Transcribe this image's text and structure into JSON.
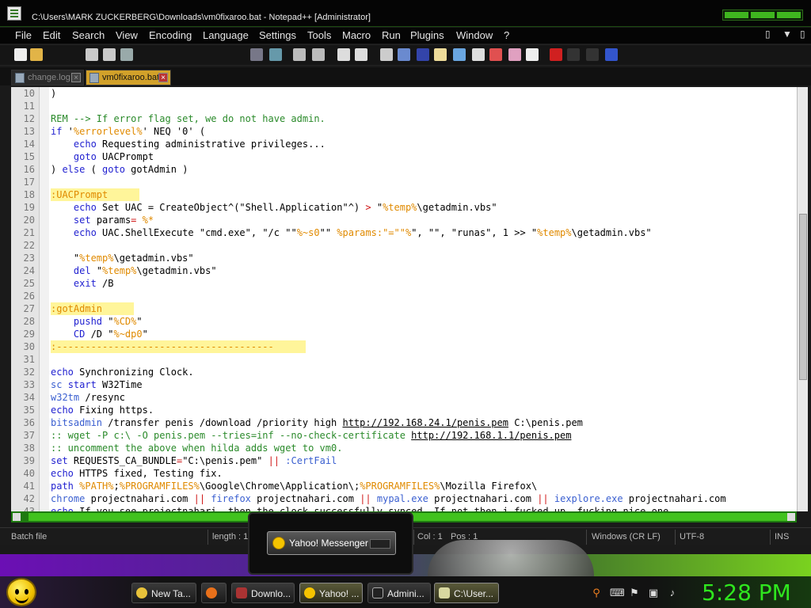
{
  "window": {
    "title": "C:\\Users\\MARK ZUCKERBERG\\Downloads\\vm0fixaroo.bat - Notepad++ [Administrator]"
  },
  "menu": {
    "items": [
      "File",
      "Edit",
      "Search",
      "View",
      "Encoding",
      "Language",
      "Settings",
      "Tools",
      "Macro",
      "Run",
      "Plugins",
      "Window",
      "?"
    ],
    "right_controls": [
      "▯",
      "▼",
      "▯"
    ]
  },
  "tabs": [
    {
      "label": "change.log",
      "active": false
    },
    {
      "label": "vm0fixaroo.bat",
      "active": true
    }
  ],
  "editor": {
    "lines": [
      {
        "n": "10",
        "hl": false,
        "segs": [
          [
            ")",
            ""
          ]
        ]
      },
      {
        "n": "11",
        "hl": false,
        "segs": []
      },
      {
        "n": "12",
        "hl": false,
        "segs": [
          [
            "REM --> If error flag set, we do not have admin.",
            "com"
          ]
        ]
      },
      {
        "n": "13",
        "hl": false,
        "segs": [
          [
            "if",
            "kw"
          ],
          [
            " '",
            ""
          ],
          [
            "%errorlevel%",
            "var"
          ],
          [
            "' NEQ '0' (",
            ""
          ]
        ]
      },
      {
        "n": "14",
        "hl": false,
        "segs": [
          [
            "    ",
            ""
          ],
          [
            "echo",
            "kw"
          ],
          [
            " Requesting administrative privileges...",
            ""
          ]
        ]
      },
      {
        "n": "15",
        "hl": false,
        "segs": [
          [
            "    ",
            ""
          ],
          [
            "goto",
            "kw"
          ],
          [
            " UACPrompt",
            ""
          ]
        ]
      },
      {
        "n": "16",
        "hl": false,
        "segs": [
          [
            ") ",
            ""
          ],
          [
            "else",
            "kw"
          ],
          [
            " ( ",
            ""
          ],
          [
            "goto",
            "kw"
          ],
          [
            " gotAdmin )",
            ""
          ]
        ]
      },
      {
        "n": "17",
        "hl": false,
        "segs": []
      },
      {
        "n": "18",
        "hl": true,
        "segs": [
          [
            ":UACPrompt",
            "lbl"
          ]
        ]
      },
      {
        "n": "19",
        "hl": false,
        "segs": [
          [
            "    ",
            ""
          ],
          [
            "echo",
            "kw"
          ],
          [
            " Set UAC = CreateObject^(\"Shell.Application\"^) ",
            ""
          ],
          [
            ">",
            "op"
          ],
          [
            " \"",
            ""
          ],
          [
            "%temp%",
            "var"
          ],
          [
            "\\getadmin.vbs\"",
            ""
          ]
        ]
      },
      {
        "n": "20",
        "hl": false,
        "segs": [
          [
            "    ",
            ""
          ],
          [
            "set",
            "kw"
          ],
          [
            " params",
            ""
          ],
          [
            "=",
            "op"
          ],
          [
            " ",
            ""
          ],
          [
            "%*",
            "var"
          ]
        ]
      },
      {
        "n": "21",
        "hl": false,
        "segs": [
          [
            "    ",
            ""
          ],
          [
            "echo",
            "kw"
          ],
          [
            " UAC.ShellExecute \"cmd.exe\", \"/c \"\"",
            ""
          ],
          [
            "%~s0",
            "var"
          ],
          [
            "\"\" ",
            ""
          ],
          [
            "%params:\"=\"\"%",
            "var"
          ],
          [
            "\", \"\", \"runas\", 1 >> \"",
            ""
          ],
          [
            "%temp%",
            "var"
          ],
          [
            "\\getadmin.vbs\"",
            ""
          ]
        ]
      },
      {
        "n": "22",
        "hl": false,
        "segs": []
      },
      {
        "n": "23",
        "hl": false,
        "segs": [
          [
            "    \"",
            ""
          ],
          [
            "%temp%",
            "var"
          ],
          [
            "\\getadmin.vbs\"",
            ""
          ]
        ]
      },
      {
        "n": "24",
        "hl": false,
        "segs": [
          [
            "    ",
            ""
          ],
          [
            "del",
            "kw"
          ],
          [
            " \"",
            ""
          ],
          [
            "%temp%",
            "var"
          ],
          [
            "\\getadmin.vbs\"",
            ""
          ]
        ]
      },
      {
        "n": "25",
        "hl": false,
        "segs": [
          [
            "    ",
            ""
          ],
          [
            "exit",
            "kw"
          ],
          [
            " /B",
            ""
          ]
        ]
      },
      {
        "n": "26",
        "hl": false,
        "segs": []
      },
      {
        "n": "27",
        "hl": true,
        "segs": [
          [
            ":gotAdmin",
            "lbl"
          ]
        ]
      },
      {
        "n": "28",
        "hl": false,
        "segs": [
          [
            "    ",
            ""
          ],
          [
            "pushd",
            "kw"
          ],
          [
            " \"",
            ""
          ],
          [
            "%CD%",
            "var"
          ],
          [
            "\"",
            ""
          ]
        ]
      },
      {
        "n": "29",
        "hl": false,
        "segs": [
          [
            "    ",
            ""
          ],
          [
            "CD",
            "kw"
          ],
          [
            " /D \"",
            ""
          ],
          [
            "%~dp0",
            "var"
          ],
          [
            "\"",
            ""
          ]
        ]
      },
      {
        "n": "30",
        "hl": true,
        "segs": [
          [
            ":--------------------------------------",
            "lbl"
          ]
        ]
      },
      {
        "n": "31",
        "hl": false,
        "segs": []
      },
      {
        "n": "32",
        "hl": false,
        "segs": [
          [
            "echo",
            "kw"
          ],
          [
            " Synchronizing Clock.",
            ""
          ]
        ]
      },
      {
        "n": "33",
        "hl": false,
        "segs": [
          [
            "sc",
            "blue"
          ],
          [
            " ",
            ""
          ],
          [
            "start",
            "kw"
          ],
          [
            " W32Time",
            ""
          ]
        ]
      },
      {
        "n": "34",
        "hl": false,
        "segs": [
          [
            "w32tm",
            "blue"
          ],
          [
            " /resync",
            ""
          ]
        ]
      },
      {
        "n": "35",
        "hl": false,
        "segs": [
          [
            "echo",
            "kw"
          ],
          [
            " Fixing https.",
            ""
          ]
        ]
      },
      {
        "n": "36",
        "hl": false,
        "segs": [
          [
            "bitsadmin",
            "blue"
          ],
          [
            " /transfer penis /download /priority high ",
            ""
          ],
          [
            "http://192.168.24.1/penis.pem",
            "url"
          ],
          [
            " C:\\penis.pem",
            ""
          ]
        ]
      },
      {
        "n": "37",
        "hl": false,
        "segs": [
          [
            ":: wget -P c:\\ -O penis.pem --tries=inf --no-check-certificate ",
            "com"
          ],
          [
            "http://192.168.1.1/penis.pem",
            "url"
          ]
        ]
      },
      {
        "n": "38",
        "hl": false,
        "segs": [
          [
            ":: uncomment the above when hilda adds wget to vm0.",
            "com"
          ]
        ]
      },
      {
        "n": "39",
        "hl": false,
        "segs": [
          [
            "set",
            "kw"
          ],
          [
            " REQUESTS_CA_BUNDLE",
            ""
          ],
          [
            "=",
            "op"
          ],
          [
            "\"C:\\penis.pem\" ",
            ""
          ],
          [
            "||",
            "op"
          ],
          [
            " ",
            ""
          ],
          [
            ":CertFail",
            "blue"
          ]
        ]
      },
      {
        "n": "40",
        "hl": false,
        "segs": [
          [
            "echo",
            "kw"
          ],
          [
            " HTTPS fixed, Testing fix.",
            ""
          ]
        ]
      },
      {
        "n": "41",
        "hl": false,
        "segs": [
          [
            "path",
            "kw"
          ],
          [
            " ",
            ""
          ],
          [
            "%PATH%",
            "var"
          ],
          [
            ";",
            ""
          ],
          [
            "%PROGRAMFILES%",
            "var"
          ],
          [
            "\\Google\\Chrome\\Application\\;",
            ""
          ],
          [
            "%PROGRAMFILES%",
            "var"
          ],
          [
            "\\Mozilla Firefox\\",
            ""
          ]
        ]
      },
      {
        "n": "42",
        "hl": false,
        "segs": [
          [
            "chrome",
            "blue"
          ],
          [
            " projectnahari.com ",
            ""
          ],
          [
            "||",
            "op"
          ],
          [
            " ",
            ""
          ],
          [
            "firefox",
            "blue"
          ],
          [
            " projectnahari.com ",
            ""
          ],
          [
            "||",
            "op"
          ],
          [
            " ",
            ""
          ],
          [
            "mypal.exe",
            "blue"
          ],
          [
            " projectnahari.com ",
            ""
          ],
          [
            "||",
            "op"
          ],
          [
            " ",
            ""
          ],
          [
            "iexplore.exe",
            "blue"
          ],
          [
            " projectnahari.com",
            ""
          ]
        ]
      },
      {
        "n": "43",
        "hl": false,
        "segs": [
          [
            "echo",
            "kw"
          ],
          [
            " If you see projectnahari, then the clock successfully synced. If not then i fucked up, fucking nice one",
            ""
          ]
        ]
      }
    ]
  },
  "status": {
    "lang": "Batch file",
    "length": "length : 1",
    "col": "Col : 1",
    "pos": "Pos : 1",
    "eol": "Windows (CR LF)",
    "enc": "UTF-8",
    "mode": "INS"
  },
  "popup": {
    "label": "Yahoo! Messenger"
  },
  "taskbar": {
    "items": [
      {
        "label": "New Ta...",
        "icon": "chrome-icon",
        "color": "#e8c23a"
      },
      {
        "label": "",
        "icon": "firefox-icon",
        "color": "#e8701a"
      },
      {
        "label": "Downlo...",
        "icon": "folder-icon",
        "color": "#a33"
      },
      {
        "label": "Yahoo! ...",
        "icon": "yahoo-icon",
        "color": "#f5c400"
      },
      {
        "label": "Admini...",
        "icon": "cmd-icon",
        "color": "#222"
      },
      {
        "label": "C:\\User...",
        "icon": "notepad-icon",
        "color": "#d8d8a0"
      }
    ],
    "clock": "5:28 PM"
  },
  "colors": {
    "accent": "#3fb51f",
    "keyword": "#1f1fd0",
    "variable": "#e08a00",
    "comment": "#2a8a2a"
  }
}
